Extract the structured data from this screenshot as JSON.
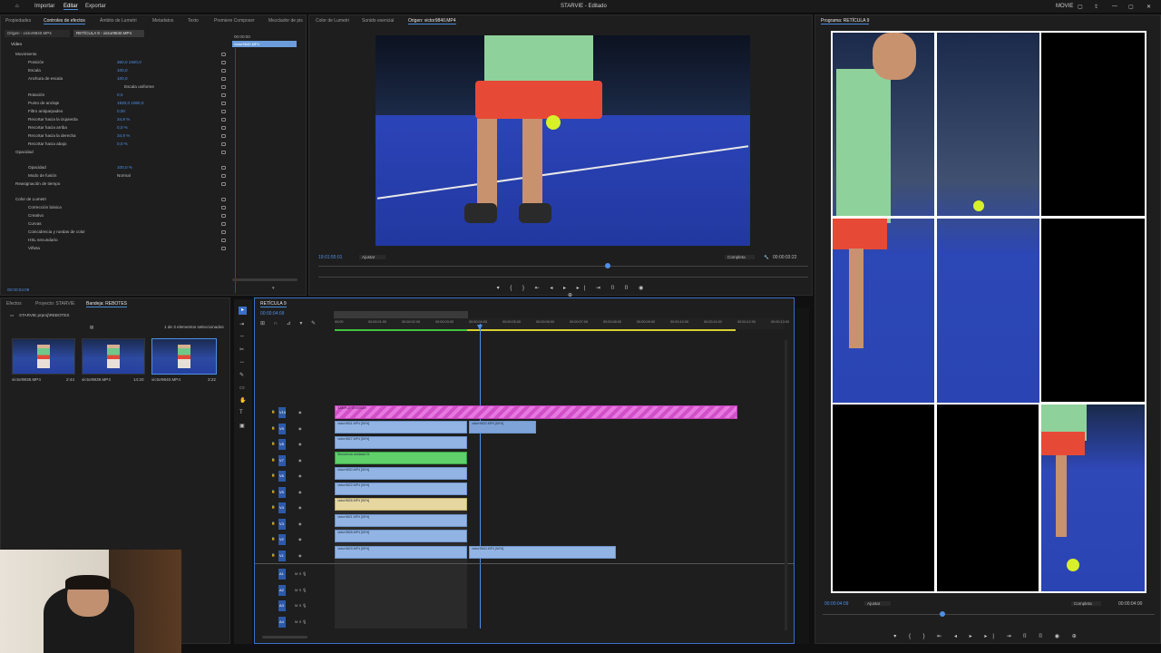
{
  "app": {
    "title": "STARVIE - Editado",
    "menu": [
      "Importar",
      "Editar",
      "Exportar"
    ],
    "right_label": "MOVIE"
  },
  "effect_controls": {
    "tabs": [
      "Propiedades",
      "Controles de efectos",
      "Ámbito de Lumetri",
      "Metadatos",
      "Texto",
      "Premiere Composer",
      "Mezclador de pis"
    ],
    "source": "Origen - victor9840.MP4",
    "sequence": "RETÍCULA 9 - victor9840.MP4",
    "clip_time": "00:00:00",
    "clip_name": "victor9840.MP4",
    "section": "Vídeo",
    "rows": [
      {
        "label": "Movimiento",
        "value": ""
      },
      {
        "label": "Posición",
        "value": "360,0    1920,0"
      },
      {
        "label": "Escala",
        "value": "100,0"
      },
      {
        "label": "Anchura de escala",
        "value": "100,0"
      },
      {
        "label": "",
        "value": "Escala uniforme"
      },
      {
        "label": "Rotación",
        "value": "0,0"
      },
      {
        "label": "Punto de anclaje",
        "value": "1920,0    1080,0"
      },
      {
        "label": "Filtro antiparpadeo",
        "value": "0,00"
      },
      {
        "label": "Recortar hacia la izquierda",
        "value": "34,9 %"
      },
      {
        "label": "Recortar hacia arriba",
        "value": "0,0 %"
      },
      {
        "label": "Recortar hacia la derecha",
        "value": "34,9 %"
      },
      {
        "label": "Recortar hacia abajo",
        "value": "0,0 %"
      },
      {
        "label": "Opacidad",
        "value": ""
      },
      {
        "label": "Opacidad",
        "value": "100,0 %"
      },
      {
        "label": "Modo de fusión",
        "value": "Normal"
      },
      {
        "label": "Reasignación de tiempo",
        "value": ""
      },
      {
        "label": "Color de Lumetri",
        "value": ""
      },
      {
        "label": "Corrección básica",
        "value": ""
      },
      {
        "label": "Creativo",
        "value": ""
      },
      {
        "label": "Curvas",
        "value": ""
      },
      {
        "label": "Coincidencia y ruedas de color",
        "value": ""
      },
      {
        "label": "HSL secundario",
        "value": ""
      },
      {
        "label": "Viñeta",
        "value": ""
      }
    ],
    "timecode": "00:00:04:09"
  },
  "source_monitor": {
    "tabs": [
      "Color de Lumetri",
      "Sonido esencial",
      "Origen: victor9840.MP4"
    ],
    "timecode": "19:01:55:01",
    "fit": "Ajustar",
    "quality": "Completa",
    "duration": "00:00:03:22"
  },
  "program_monitor": {
    "title": "Programa: RETÍCULA 9",
    "timecode": "00:00:04:09",
    "fit": "Ajustar",
    "quality": "Completa",
    "duration": "00:00:04:00"
  },
  "project": {
    "tabs": [
      "Efectos",
      "Proyecto: STARVIE",
      "Bandeja: REBOTES"
    ],
    "path": "STARVIE.prproj\\REBOTES",
    "selection": "1 de 3 elementos seleccionados",
    "items": [
      {
        "name": "victor9838.MP4",
        "dur": "2:44"
      },
      {
        "name": "victor9839.MP4",
        "dur": "14:20"
      },
      {
        "name": "victor9840.MP4",
        "dur": "3:22"
      }
    ]
  },
  "timeline": {
    "sequence": "RETÍCULA 9",
    "timecode": "00:00:04:09",
    "ruler": [
      "00:00",
      "00:00:01:00",
      "00:00:02:00",
      "00:00:03:00",
      "00:00:04:00",
      "00:00:05:00",
      "00:00:06:00",
      "00:00:07:00",
      "00:00:08:00",
      "00:00:09:00",
      "00:00:10:00",
      "00:00:11:00",
      "00:00:12:00",
      "00:00:13:00"
    ],
    "video_tracks": [
      "V10",
      "V9",
      "V8",
      "V7",
      "V6",
      "V5",
      "V4",
      "V3",
      "V2",
      "V1"
    ],
    "audio_tracks": [
      "A1",
      "A2",
      "A3",
      "A4"
    ],
    "clips": {
      "v10": "SAMPLE OVERLAY",
      "v9a": "victor9831.MP4 [50%]",
      "v9b": "victor9832.MP4 [50%]",
      "v8": "victor9827.MP4 [50%]",
      "v7": "Secuencia anidada 01",
      "v6": "victor9830.MP4 [50%]",
      "v5": "victor9822.MP4 [50%]",
      "v4": "victor9826.MP4 [50%]",
      "v3": "victor9821.MP4 [50%]",
      "v2": "victor9828.MP4 [50%]",
      "v1a": "victor9829.MP4 [50%]",
      "v1b": "victor9840.MP4 [50%]"
    }
  }
}
